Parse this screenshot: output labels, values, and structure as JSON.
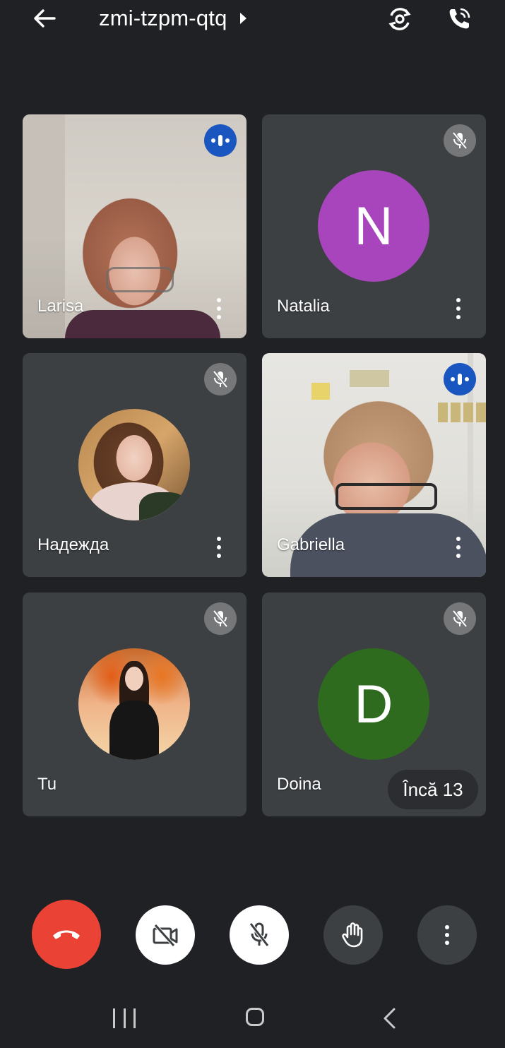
{
  "header": {
    "meeting_code": "zmi-tzpm-qtq",
    "icons": [
      "back-arrow-icon",
      "caret-right-icon",
      "switch-camera-icon",
      "phone-audio-icon"
    ]
  },
  "participants": [
    {
      "name": "Larisa",
      "status": "speaking",
      "display": "video"
    },
    {
      "name": "Natalia",
      "status": "muted",
      "display": "avatar-letter",
      "initial": "N",
      "avatar_color": "#a845bd"
    },
    {
      "name": "Надежда",
      "status": "muted",
      "display": "avatar-photo"
    },
    {
      "name": "Gabriella",
      "status": "speaking",
      "display": "video"
    },
    {
      "name": "Tu",
      "status": "muted",
      "display": "avatar-photo"
    },
    {
      "name": "Doina",
      "status": "muted",
      "display": "avatar-letter",
      "initial": "D",
      "avatar_color": "#2e6b1f"
    }
  ],
  "more_participants": {
    "label": "Încă 13"
  },
  "controls": {
    "icons": [
      "end-call-icon",
      "camera-off-icon",
      "mic-off-icon",
      "raise-hand-icon",
      "more-vert-icon"
    ],
    "end_call_color": "#ea4335"
  },
  "system_nav": {
    "icons": [
      "recents-icon",
      "home-icon",
      "back-icon"
    ]
  },
  "colors": {
    "background": "#202124",
    "tile": "#3c4043",
    "speaking_badge": "#1a56c0",
    "muted_badge": "#757779"
  }
}
